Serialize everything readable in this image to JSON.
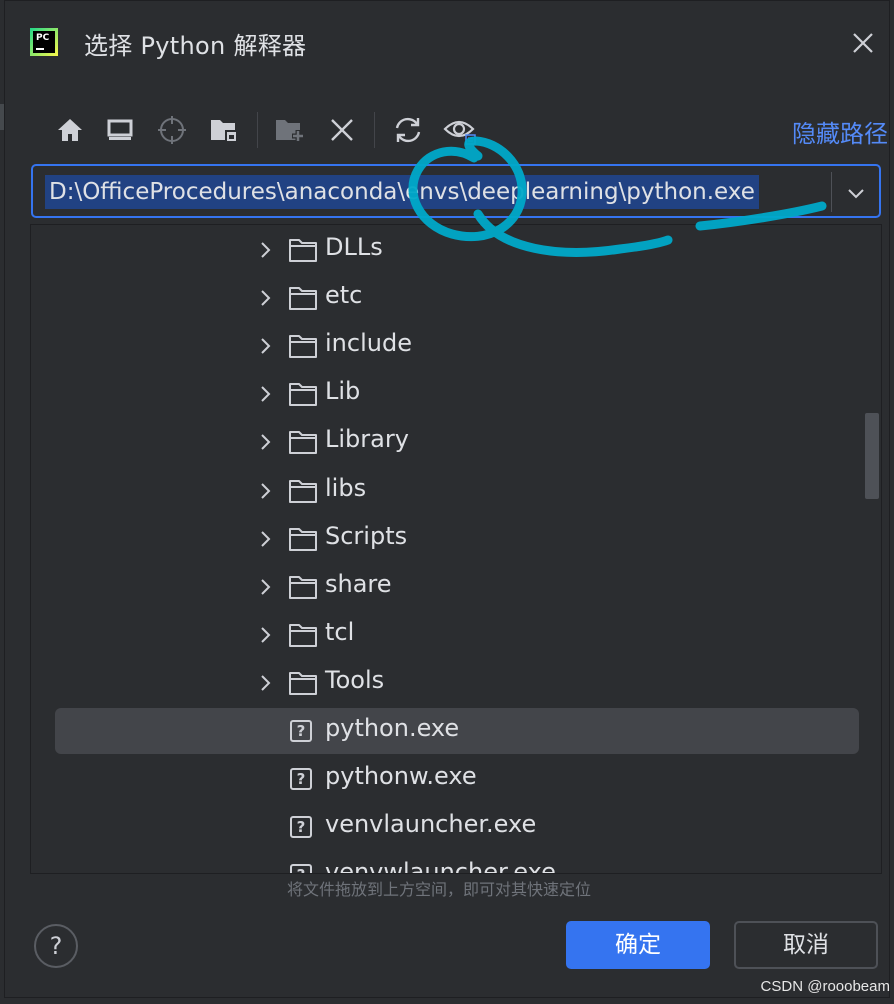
{
  "dialog": {
    "title": "选择 Python 解释器",
    "app_icon_text": "PC",
    "hide_path_label": "隐藏路径"
  },
  "toolbar": {
    "buttons": [
      "home-icon",
      "desktop-icon",
      "locate-icon",
      "project-folder-icon",
      "new-folder-icon",
      "delete-icon",
      "refresh-icon",
      "show-hidden-icon"
    ]
  },
  "path_field": {
    "value": "D:\\OfficeProcedures\\anaconda\\envs\\deeplearning\\python.exe"
  },
  "tree": {
    "items": [
      {
        "label": "DLLs",
        "type": "folder"
      },
      {
        "label": "etc",
        "type": "folder"
      },
      {
        "label": "include",
        "type": "folder"
      },
      {
        "label": "Lib",
        "type": "folder"
      },
      {
        "label": "Library",
        "type": "folder"
      },
      {
        "label": "libs",
        "type": "folder"
      },
      {
        "label": "Scripts",
        "type": "folder"
      },
      {
        "label": "share",
        "type": "folder"
      },
      {
        "label": "tcl",
        "type": "folder"
      },
      {
        "label": "Tools",
        "type": "folder"
      },
      {
        "label": "python.exe",
        "type": "file",
        "selected": true
      },
      {
        "label": "pythonw.exe",
        "type": "file"
      },
      {
        "label": "venvlauncher.exe",
        "type": "file"
      },
      {
        "label": "venvwlauncher.exe",
        "type": "file"
      }
    ]
  },
  "hint": "将文件拖放到上方空间，即可对其快速定位",
  "footer": {
    "help_label": "?",
    "ok_label": "确定",
    "cancel_label": "取消"
  },
  "watermark": "CSDN @rooobeam",
  "colors": {
    "background": "#2b2d30",
    "accent": "#3574f0",
    "selection": "#43454a",
    "text_selection": "#214283",
    "link": "#548af7",
    "annotation_ink": "#00a9c9"
  }
}
